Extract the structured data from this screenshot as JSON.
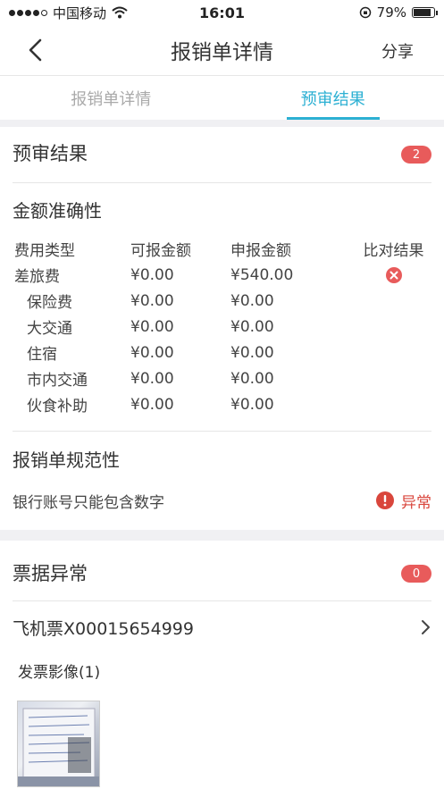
{
  "status_bar": {
    "carrier": "中国移动",
    "time": "16:01",
    "battery": "79%"
  },
  "nav": {
    "title": "报销单详情",
    "share": "分享"
  },
  "tabs": [
    {
      "label": "报销单详情",
      "active": false
    },
    {
      "label": "预审结果",
      "active": true
    }
  ],
  "pre_review": {
    "title": "预审结果",
    "count": "2"
  },
  "amount_accuracy": {
    "title": "金额准确性",
    "headers": [
      "费用类型",
      "可报金额",
      "申报金额",
      "比对结果"
    ],
    "rows": [
      {
        "type": "差旅费",
        "reimbursable": "¥0.00",
        "declared": "¥540.00",
        "mismatch": true
      },
      {
        "type": "保险费",
        "reimbursable": "¥0.00",
        "declared": "¥0.00"
      },
      {
        "type": "大交通",
        "reimbursable": "¥0.00",
        "declared": "¥0.00"
      },
      {
        "type": "住宿",
        "reimbursable": "¥0.00",
        "declared": "¥0.00"
      },
      {
        "type": "市内交通",
        "reimbursable": "¥0.00",
        "declared": "¥0.00"
      },
      {
        "type": "伙食补助",
        "reimbursable": "¥0.00",
        "declared": "¥0.00"
      }
    ]
  },
  "standard": {
    "title": "报销单规范性",
    "rule": "银行账号只能包含数字",
    "status": "异常"
  },
  "ticket_anomaly": {
    "title": "票据异常",
    "count": "0",
    "ticket": "飞机票X00015654999",
    "invoice_label": "发票影像(1)"
  },
  "colors": {
    "accent": "#2cb0d3",
    "badge": "#e85b5b",
    "error": "#d9463c"
  }
}
